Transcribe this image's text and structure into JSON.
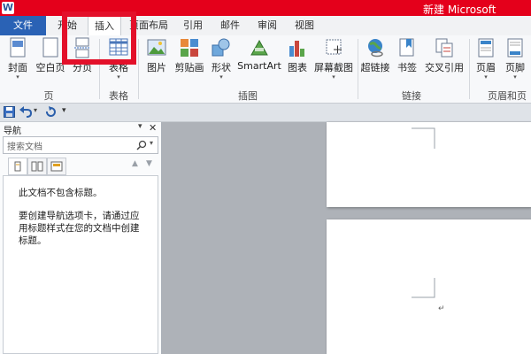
{
  "window": {
    "app_icon_letter": "W",
    "title": "新建 Microsoft"
  },
  "tabs": [
    "文件",
    "开始",
    "插入",
    "页面布局",
    "引用",
    "邮件",
    "审阅",
    "视图"
  ],
  "ribbon": {
    "pages": {
      "cover": "封面",
      "blank": "空白页",
      "break": "分页",
      "label": "页"
    },
    "table": {
      "table": "表格",
      "label": "表格"
    },
    "illustrations": {
      "picture": "图片",
      "clipart": "剪贴画",
      "shapes": "形状",
      "smartart": "SmartArt",
      "chart": "图表",
      "screenshot": "屏幕截图",
      "label": "插图"
    },
    "links": {
      "hyperlink": "超链接",
      "bookmark": "书签",
      "crossref": "交叉引用",
      "label": "链接"
    },
    "headerfooter": {
      "header": "页眉",
      "footer": "页脚",
      "label": "页眉和页"
    }
  },
  "nav": {
    "title": "导航",
    "search_placeholder": "搜索文档",
    "no_headings": "此文档不包含标题。",
    "help": "要创建导航选项卡，请通过应用标题样式在您的文档中创建标题。"
  },
  "colors": {
    "title_bar": "#e4001b",
    "file_tab": "#2a62b5",
    "highlight": "#e3102a"
  }
}
